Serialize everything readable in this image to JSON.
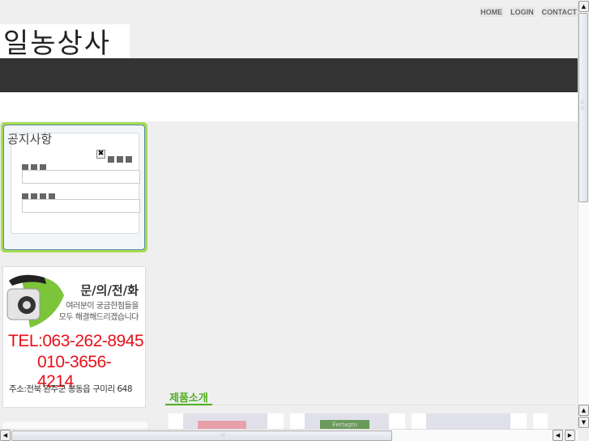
{
  "nav": {
    "home": "HOME",
    "login": "LOGIN",
    "contact": "CONTACT"
  },
  "logo": "일농상사",
  "notice": {
    "title": "공지사항"
  },
  "contact": {
    "title": "문/의/전/화",
    "sub1": "여러분이 궁금한점들을",
    "sub2": "모두 해결해드리겠습니다",
    "tel1": "TEL:063-262-8945",
    "tel2": "010-3656-4214",
    "address": "주소:전북 완주군 봉동읍 구미리 648"
  },
  "products": {
    "title": "제품소개",
    "thumb_label": "Fertagro"
  }
}
